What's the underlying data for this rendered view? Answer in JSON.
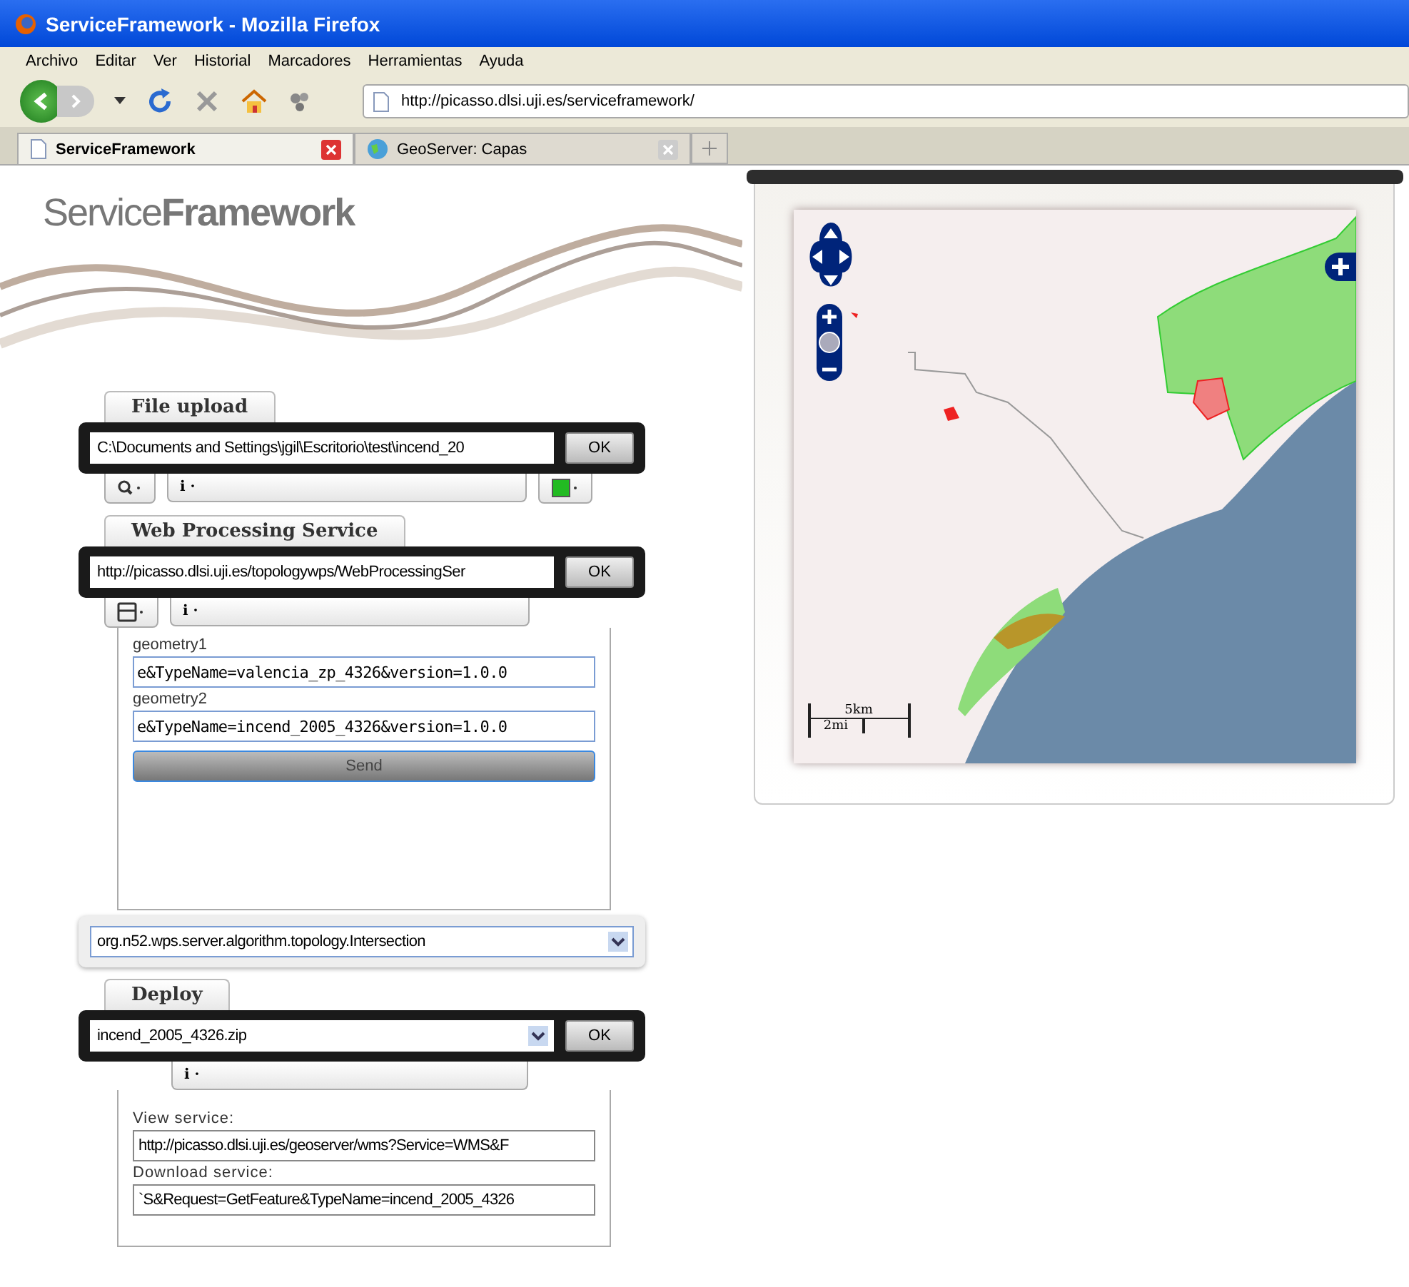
{
  "window": {
    "title": "ServiceFramework - Mozilla Firefox"
  },
  "menu": [
    "Archivo",
    "Editar",
    "Ver",
    "Historial",
    "Marcadores",
    "Herramientas",
    "Ayuda"
  ],
  "address": "http://picasso.dlsi.uji.es/serviceframework/",
  "tabs": [
    {
      "label": "ServiceFramework",
      "selected": true
    },
    {
      "label": "GeoServer: Capas",
      "selected": false
    }
  ],
  "logo": "Service**Framework**",
  "file_upload": {
    "title": "File upload",
    "path": "C:\\Documents and Settings\\jgil\\Escritorio\\test\\incend_20",
    "button": "OK",
    "info": "i ·"
  },
  "wps": {
    "title": "Web Processing Service",
    "url": "http://picasso.dlsi.uji.es/topologywps/WebProcessingSer",
    "button": "OK",
    "info": "i ·",
    "params": [
      {
        "label": "geometry1",
        "value": "e&TypeName=valencia_zp_4326&version=1.0.0"
      },
      {
        "label": "geometry2",
        "value": "e&TypeName=incend_2005_4326&version=1.0.0"
      }
    ],
    "send": "Send",
    "algorithm": "org.n52.wps.server.algorithm.topology.Intersection"
  },
  "deploy": {
    "title": "Deploy",
    "file": "incend_2005_4326.zip",
    "button": "OK",
    "info": "i ·",
    "view_label": "View service:",
    "view_url": "http://picasso.dlsi.uji.es/geoserver/wms?Service=WMS&F",
    "download_label": "Download  service:",
    "download_url": "`S&Request=GetFeature&TypeName=incend_2005_4326"
  },
  "map": {
    "scale_km": "5km",
    "scale_mi": "2mi"
  }
}
